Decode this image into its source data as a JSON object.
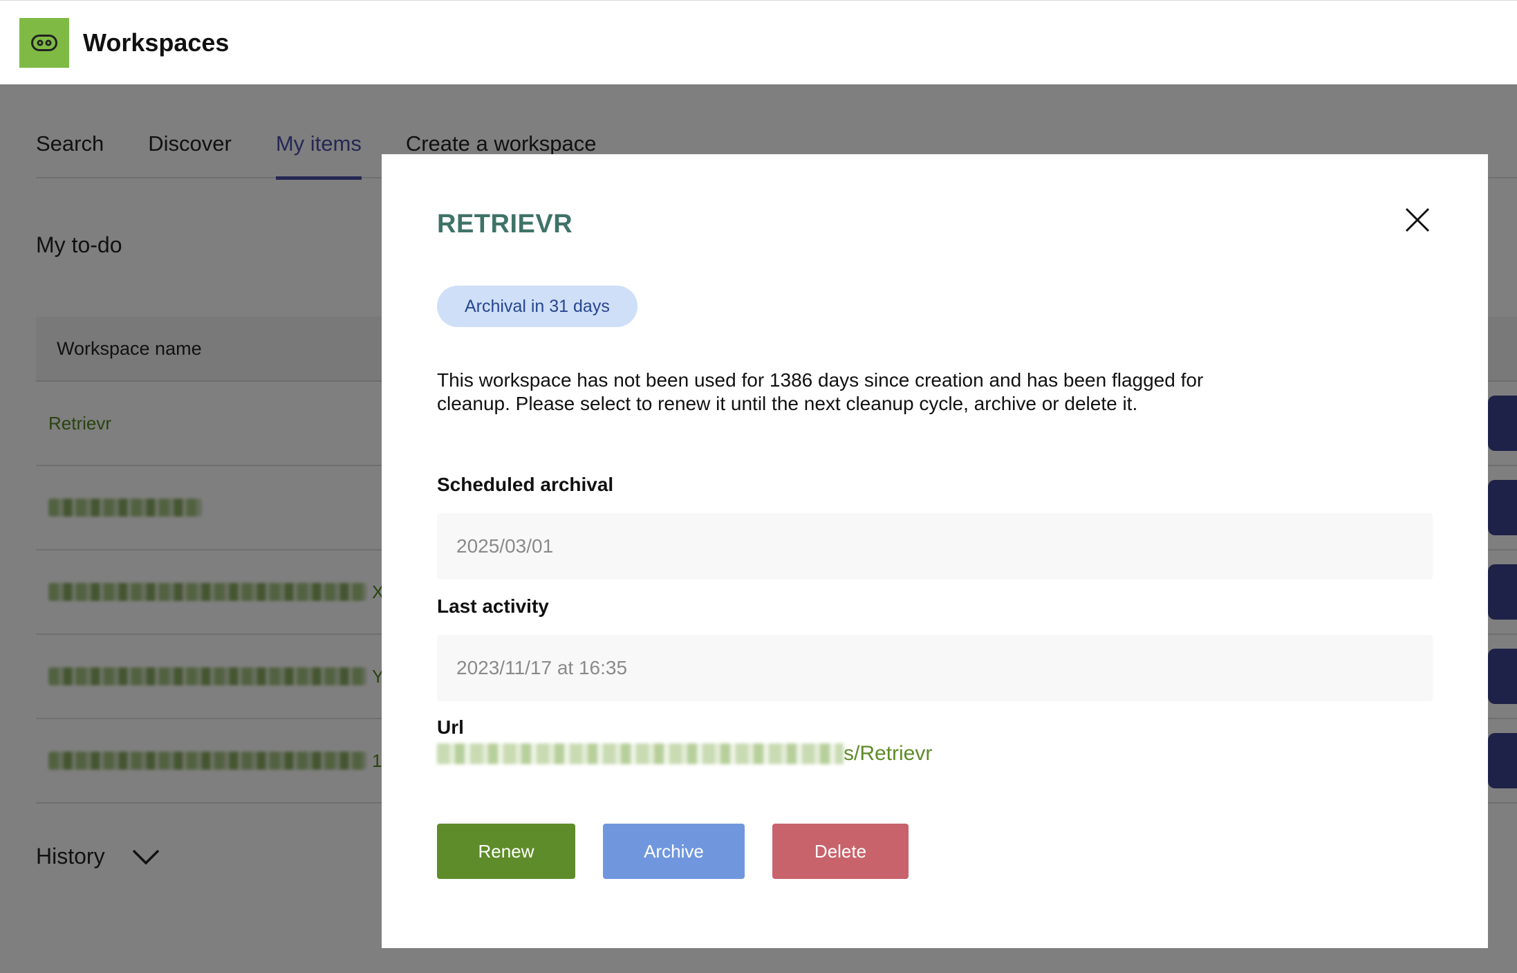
{
  "header": {
    "app_title": "Workspaces",
    "logo_icon": "workspaces-logo-icon",
    "logo_color": "#7fba45"
  },
  "tabs": [
    {
      "label": "Search",
      "active": false
    },
    {
      "label": "Discover",
      "active": false
    },
    {
      "label": "My items",
      "active": true
    },
    {
      "label": "Create a workspace",
      "active": false
    }
  ],
  "todo": {
    "title": "My to-do",
    "column_header": "Workspace name",
    "rows": [
      {
        "name": "Retrievr",
        "redacted": false
      },
      {
        "name": "",
        "redacted": true,
        "suffix": ""
      },
      {
        "name": "",
        "redacted": true,
        "suffix": "X"
      },
      {
        "name": "",
        "redacted": true,
        "suffix": "Y"
      },
      {
        "name": "",
        "redacted": true,
        "suffix": "1"
      }
    ]
  },
  "history": {
    "label": "History",
    "icon": "chevron-down-icon"
  },
  "modal": {
    "title": "RETRIEVR",
    "badge": "Archival in 31 days",
    "description": "This workspace has not been used for 1386 days since creation and has been flagged for cleanup. Please select to renew it until the next cleanup cycle, archive or delete it.",
    "scheduled_archival_label": "Scheduled archival",
    "scheduled_archival_value": "2025/03/01",
    "last_activity_label": "Last activity",
    "last_activity_value": "2023/11/17 at 16:35",
    "url_label": "Url",
    "url_visible_suffix": "s/Retrievr",
    "buttons": {
      "renew": "Renew",
      "archive": "Archive",
      "delete": "Delete"
    },
    "close_icon": "close-icon"
  },
  "colors": {
    "accent": "#4b51a8",
    "title_teal": "#3f7368",
    "renew": "#5e8c2a",
    "archive": "#7097dd",
    "delete": "#c8636b",
    "link_green": "#5d8b27",
    "badge_bg": "#cfdff8"
  }
}
